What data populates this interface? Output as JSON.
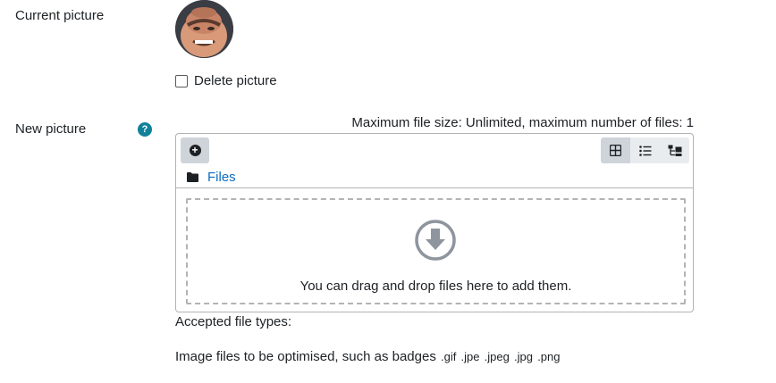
{
  "current_picture": {
    "label": "Current picture",
    "delete_label": "Delete picture"
  },
  "new_picture": {
    "label": "New picture",
    "help_icon": "?",
    "max_size_text": "Maximum file size: Unlimited, maximum number of files: 1"
  },
  "filemanager": {
    "add_icon": "+",
    "path_label": "Files",
    "drop_text": "You can drag and drop files here to add them.",
    "views": [
      "grid-view-icon",
      "list-view-icon",
      "tree-view-icon"
    ],
    "active_view": "grid-view-icon"
  },
  "accepted": {
    "heading": "Accepted file types:",
    "description": "Image files to be optimised, such as badges",
    "extensions": [
      ".gif",
      ".jpe",
      ".jpeg",
      ".jpg",
      ".png"
    ]
  },
  "colors": {
    "link": "#0f6cbf",
    "help": "#11819a",
    "border": "#b3b3b3"
  }
}
